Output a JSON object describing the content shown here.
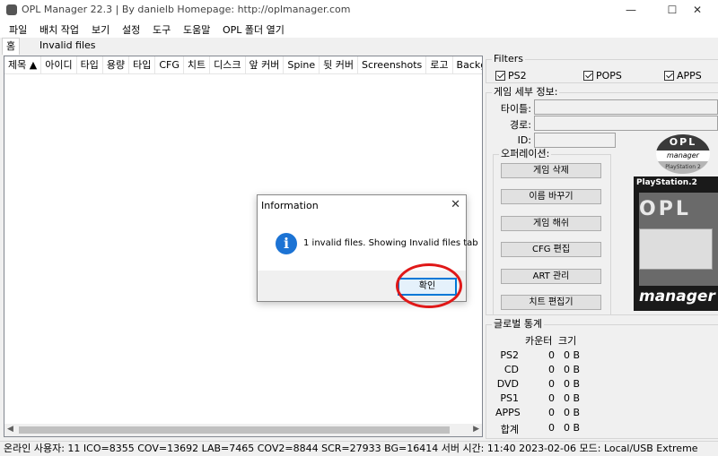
{
  "window": {
    "title": "OPL Manager 22.3 | By danielb Homepage: http://oplmanager.com"
  },
  "menu": [
    "파일",
    "배치 작업",
    "보기",
    "설정",
    "도구",
    "도움말",
    "OPL 폴더 열기"
  ],
  "tabs": [
    "홈",
    "Invalid files"
  ],
  "game_list": {
    "columns": [
      "제목 ▲",
      "아이디",
      "타입",
      "용량",
      "타입",
      "CFG",
      "치트",
      "디스크",
      "앞 커버",
      "Spine",
      "뒷 커버",
      "Screenshots",
      "로고",
      "Background"
    ]
  },
  "filters": {
    "title": "Filters",
    "items": [
      {
        "label": "PS2",
        "checked": true
      },
      {
        "label": "POPS",
        "checked": true
      },
      {
        "label": "APPS",
        "checked": true
      }
    ]
  },
  "details": {
    "title": "게임 세부 정보:",
    "title_label": "타이틀:",
    "path_label": "경로:",
    "id_label": "ID:"
  },
  "operations": {
    "title": "오퍼레이션:",
    "buttons": [
      "게임 삭제",
      "이름 바꾸기",
      "게임 해쉬",
      "CFG 편집",
      "ART 관리",
      "치트 편집기"
    ]
  },
  "logo": {
    "top": "OPL",
    "mid": "manager",
    "bottom": "PlayStation 2"
  },
  "cover": {
    "title": "PlayStation.2",
    "opl": "OPL",
    "manager": "manager"
  },
  "stats": {
    "title": "글로벌 통계",
    "count_header": "카운터",
    "size_header": "크기",
    "rows": [
      {
        "label": "PS2",
        "count": "0",
        "size": "0 B"
      },
      {
        "label": "CD",
        "count": "0",
        "size": "0 B"
      },
      {
        "label": "DVD",
        "count": "0",
        "size": "0 B"
      },
      {
        "label": "PS1",
        "count": "0",
        "size": "0 B"
      },
      {
        "label": "APPS",
        "count": "0",
        "size": "0 B"
      },
      {
        "label": "합계",
        "count": "0",
        "size": "0 B"
      }
    ]
  },
  "status": "온라인 사용자: 11  ICO=8355   COV=13692   LAB=7465   COV2=8844   SCR=27933   BG=16414  서버 시간: 11:40 2023-02-06  모드: Local/USB Extreme",
  "dialog": {
    "title": "Information",
    "message": "1 invalid files. Showing Invalid files tab",
    "ok": "확인",
    "close": "✕",
    "info_symbol": "i"
  },
  "colors": {
    "highlight_circle": "#e01818",
    "info_blue": "#1c73d4"
  }
}
